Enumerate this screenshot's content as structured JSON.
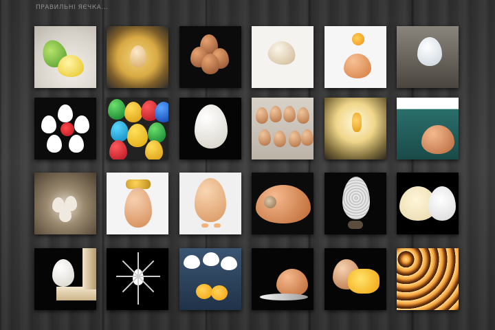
{
  "page": {
    "title": "ПРАВИЛЬНІ ЯЄЧКА..."
  },
  "grid": {
    "rows": 4,
    "cols": 6,
    "tiles": [
      {
        "id": "1",
        "caption": ""
      },
      {
        "id": "2",
        "caption": ""
      },
      {
        "id": "3",
        "caption": ""
      },
      {
        "id": "4",
        "caption": ""
      },
      {
        "id": "5",
        "caption": ""
      },
      {
        "id": "6",
        "caption": ""
      },
      {
        "id": "7",
        "caption": ""
      },
      {
        "id": "8",
        "caption": ""
      },
      {
        "id": "9",
        "caption": ""
      },
      {
        "id": "10",
        "caption": ""
      },
      {
        "id": "11",
        "caption": ""
      },
      {
        "id": "12",
        "caption": ""
      },
      {
        "id": "13",
        "caption": ""
      },
      {
        "id": "14",
        "caption": ""
      },
      {
        "id": "15",
        "caption": ""
      },
      {
        "id": "16",
        "caption": ""
      },
      {
        "id": "17",
        "caption": ""
      },
      {
        "id": "18",
        "caption": ""
      },
      {
        "id": "19",
        "caption": ""
      },
      {
        "id": "20",
        "caption": ""
      },
      {
        "id": "21",
        "caption": ""
      },
      {
        "id": "22",
        "caption": ""
      },
      {
        "id": "23",
        "caption": ""
      },
      {
        "id": "24",
        "caption": ""
      }
    ]
  },
  "colors": {
    "background": "#333333",
    "title_text": "#8e8e8e"
  }
}
